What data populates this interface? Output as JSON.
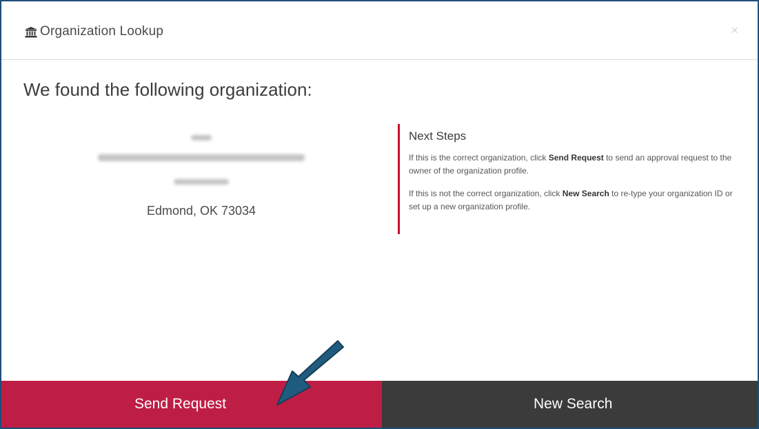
{
  "dialog": {
    "title": "Organization Lookup",
    "title_icon": "bank-icon",
    "close_label": "×"
  },
  "result": {
    "heading": "We found the following organization:",
    "org_city": "Edmond, OK 73034"
  },
  "next_steps": {
    "title": "Next Steps",
    "para1_before": "If this is the correct organization, click ",
    "para1_bold": "Send Request",
    "para1_after": " to send an approval request to the owner of the organization profile.",
    "para2_before": "If this is not the correct organization, click ",
    "para2_bold": "New Search",
    "para2_after": " to re-type your organization ID or set up a new organization profile."
  },
  "buttons": {
    "send_request": "Send Request",
    "new_search": "New Search"
  },
  "annotation": {
    "arrow_icon": "pointer-arrow-icon",
    "arrow_color": "#1f5b7e"
  },
  "colors": {
    "accent_red": "#be1e45",
    "dark_button": "#3b3b3b",
    "frame_border": "#1f4e79"
  }
}
